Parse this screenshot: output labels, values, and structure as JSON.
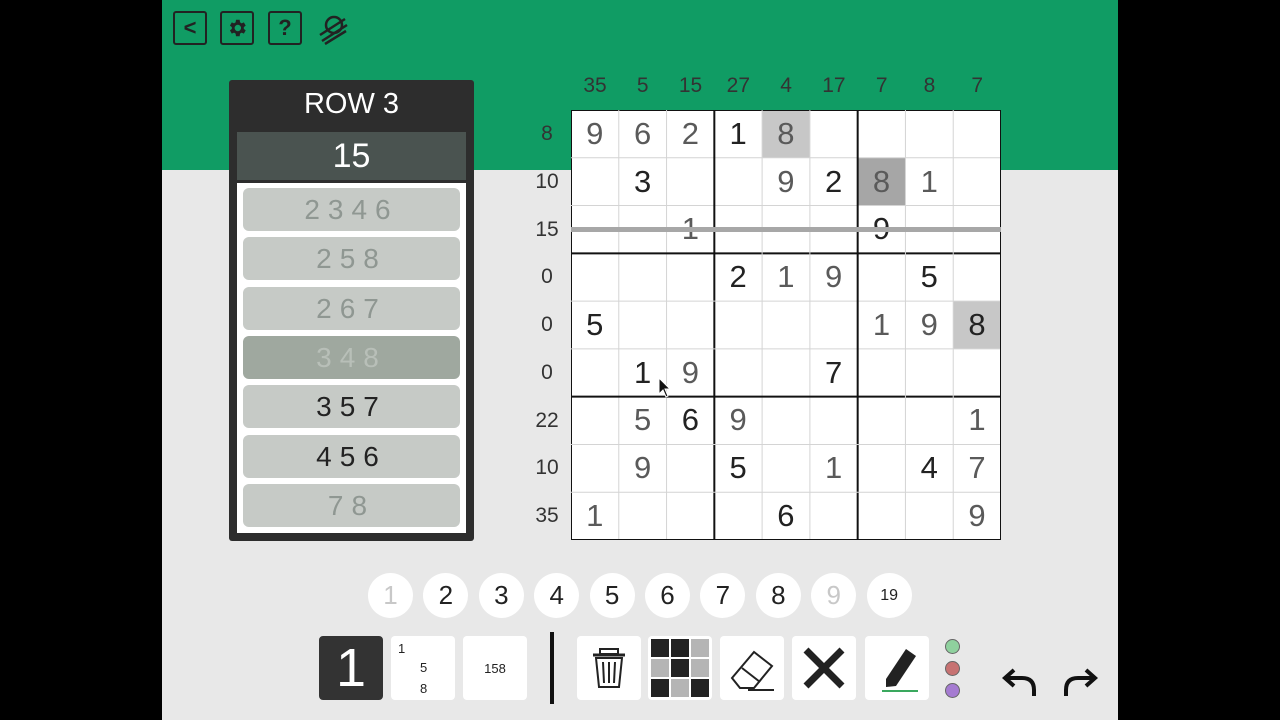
{
  "header": {
    "back_label": "<",
    "settings_icon": "gear-icon",
    "help_label": "?",
    "logo_icon": "logo-icon"
  },
  "panel": {
    "title": "ROW 3",
    "sum": "15",
    "combos": [
      "2346",
      "258",
      "267",
      "348",
      "357",
      "456",
      "78"
    ]
  },
  "column_clues": [
    "35",
    "5",
    "15",
    "27",
    "4",
    "17",
    "7",
    "8",
    "7"
  ],
  "row_clues": [
    "8",
    "10",
    "15",
    "0",
    "0",
    "0",
    "22",
    "10",
    "35"
  ],
  "grid": {
    "cells": [
      [
        "9",
        "6",
        "2",
        "1",
        "8",
        "",
        "",
        "",
        ""
      ],
      [
        "",
        "3",
        "",
        "",
        "9",
        "2",
        "8",
        "1",
        ""
      ],
      [
        "",
        "",
        "1",
        "",
        "",
        "",
        "9",
        "",
        ""
      ],
      [
        "",
        "",
        "",
        "2",
        "1",
        "9",
        "",
        "5",
        ""
      ],
      [
        "5",
        "",
        "",
        "",
        "",
        "",
        "1",
        "9",
        "8"
      ],
      [
        "",
        "1",
        "9",
        "",
        "",
        "7",
        "",
        "",
        ""
      ],
      [
        "",
        "5",
        "6",
        "9",
        "",
        "",
        "",
        "",
        "1"
      ],
      [
        "",
        "9",
        "",
        "5",
        "",
        "1",
        "",
        "4",
        "7"
      ],
      [
        "1",
        "",
        "",
        "",
        "6",
        "",
        "",
        "",
        "9"
      ]
    ]
  },
  "number_pad": [
    "1",
    "2",
    "3",
    "4",
    "5",
    "6",
    "7",
    "8",
    "9",
    "19"
  ],
  "toolbar": {
    "mode_normal": "1",
    "mode_corner_1": "1",
    "mode_corner_5": "5",
    "mode_corner_8": "8",
    "mode_center": "158",
    "delete_icon": "trash-icon",
    "shade_icon": "grid-shade-icon",
    "eraser_icon": "eraser-icon",
    "cross_icon": "cross-icon",
    "pen_icon": "pen-icon",
    "colors": [
      "#8fd19e",
      "#c77272",
      "#a57bd1"
    ],
    "undo_icon": "undo-icon",
    "redo_icon": "redo-icon"
  },
  "colors": {
    "header_green": "#109c64",
    "panel_bg": "#2d2d2d",
    "highlight": "#c7c7c7",
    "highlight_strong": "#a6a6a6"
  }
}
